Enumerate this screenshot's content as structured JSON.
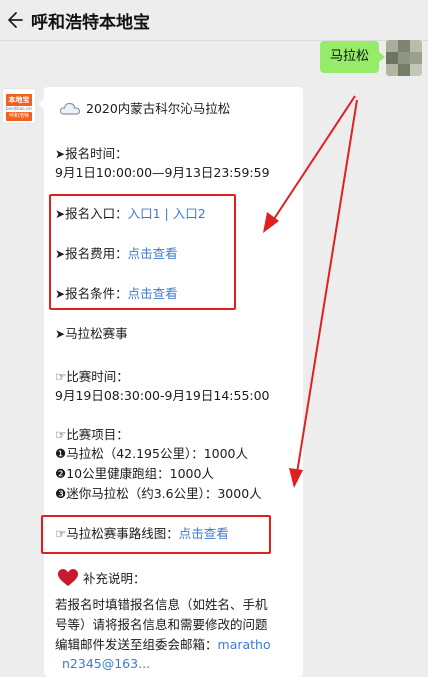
{
  "header": {
    "title": "呼和浩特本地宝",
    "back_icon": "chevron-left-icon"
  },
  "sent_message": {
    "text": "马拉松"
  },
  "bot_avatar": {
    "top": "本地宝",
    "mid": "bendibao.com",
    "bottom": "呼和浩特"
  },
  "message": {
    "title": "2020内蒙古科尔沁马拉松",
    "reg_time_label": "报名时间：",
    "reg_time_value": "9月1日10:00:00—9月13日23:59:59",
    "entry_label": "报名入口：",
    "entry_link1": "入口1",
    "entry_sep": "|",
    "entry_link2": "入口2",
    "fee_label": "报名费用：",
    "fee_link": "点击查看",
    "cond_label": "报名条件：",
    "cond_link": "点击查看",
    "section_title": "马拉松赛事",
    "race_time_label": "比赛时间：",
    "race_time_value": "9月19日08:30:00-9月19日14:55:00",
    "events_label": "比赛项目：",
    "events": [
      "❶马拉松（42.195公里）：1000人",
      "❷10公里健康跑组：1000人",
      "❸迷你马拉松（约3.6公里）：3000人"
    ],
    "route_label": "马拉松赛事路线图：",
    "route_link": "点击查看",
    "note_label": "补充说明：",
    "note_lines": [
      "若报名时填错报名信息（如姓名、手机",
      "号等）请将报名信息和需要修改的问题",
      "编辑邮件发送至组委会邮箱："
    ],
    "email_part1": "maratho",
    "email_part2": "n2345@163..."
  },
  "colors": {
    "bubble_mine": "#95ec69",
    "link": "#3d7bd3",
    "highlight": "#e02020",
    "brand": "#f2601f"
  }
}
